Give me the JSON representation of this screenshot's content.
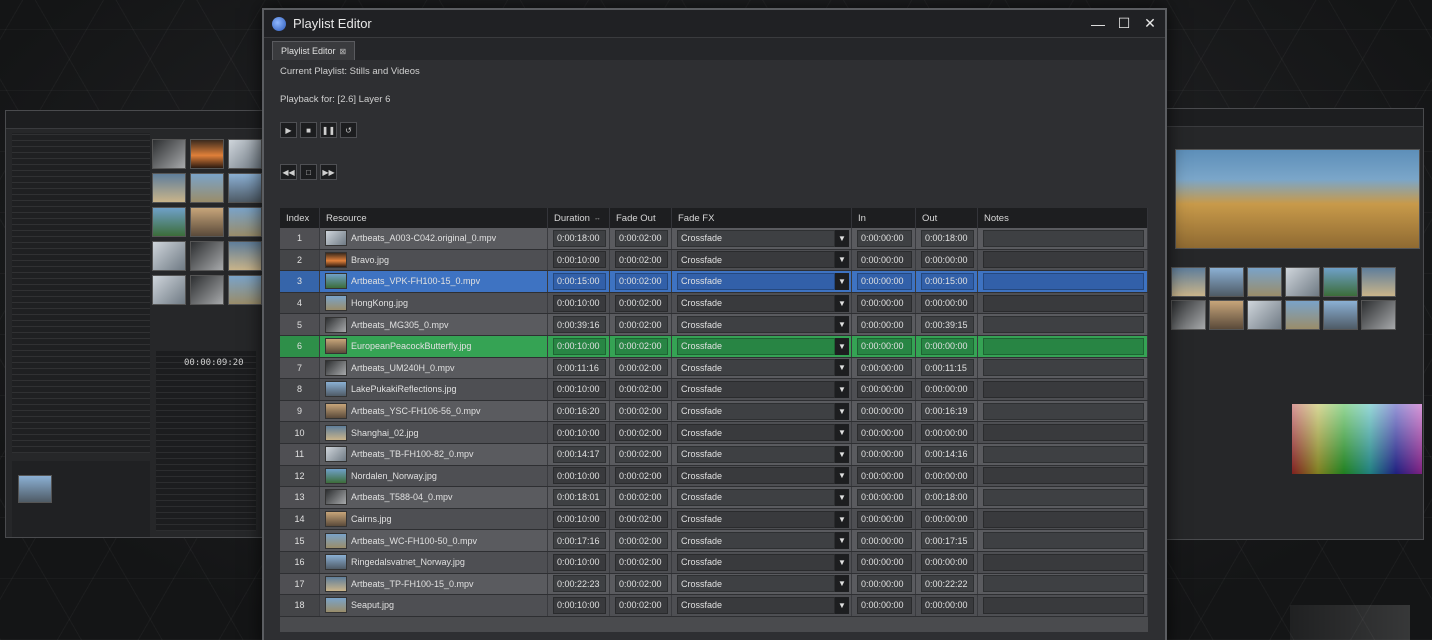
{
  "window": {
    "title": "Playlist Editor"
  },
  "tab": {
    "label": "Playlist Editor",
    "close_glyph": "⊠"
  },
  "info": {
    "current_playlist": "Current Playlist: Stills and Videos",
    "playback_for": "Playback for:  [2.6] Layer 6"
  },
  "background_app": {
    "timecode": "00:00:09:20"
  },
  "table": {
    "headers": {
      "index": "Index",
      "resource": "Resource",
      "duration": "Duration",
      "fade_out": "Fade Out",
      "fade_fx": "Fade FX",
      "in": "In",
      "out": "Out",
      "notes": "Notes"
    },
    "rows": [
      {
        "index": "1",
        "resource": "Artbeats_A003-C042.original_0.mpv",
        "duration": "0:00:18:00",
        "fade_out": "0:00:02:00",
        "fade_fx": "Crossfade",
        "in": "0:00:00:00",
        "out": "0:00:18:00",
        "thumb": "t3"
      },
      {
        "index": "2",
        "resource": "Bravo.jpg",
        "duration": "0:00:10:00",
        "fade_out": "0:00:02:00",
        "fade_fx": "Crossfade",
        "in": "0:00:00:00",
        "out": "0:00:00:00",
        "thumb": "t2"
      },
      {
        "index": "3",
        "resource": "Artbeats_VPK-FH100-15_0.mpv",
        "duration": "0:00:15:00",
        "fade_out": "0:00:02:00",
        "fade_fx": "Crossfade",
        "in": "0:00:00:00",
        "out": "0:00:15:00",
        "thumb": "t7",
        "state": "selected-blue"
      },
      {
        "index": "4",
        "resource": "HongKong.jpg",
        "duration": "0:00:10:00",
        "fade_out": "0:00:02:00",
        "fade_fx": "Crossfade",
        "in": "0:00:00:00",
        "out": "0:00:00:00",
        "thumb": "t1"
      },
      {
        "index": "5",
        "resource": "Artbeats_MG305_0.mpv",
        "duration": "0:00:39:16",
        "fade_out": "0:00:02:00",
        "fade_fx": "Crossfade",
        "in": "0:00:00:00",
        "out": "0:00:39:15",
        "thumb": "t6"
      },
      {
        "index": "6",
        "resource": "EuropeanPeacockButterfly.jpg",
        "duration": "0:00:10:00",
        "fade_out": "0:00:02:00",
        "fade_fx": "Crossfade",
        "in": "0:00:00:00",
        "out": "0:00:00:00",
        "thumb": "t8",
        "state": "selected-green"
      },
      {
        "index": "7",
        "resource": "Artbeats_UM240H_0.mpv",
        "duration": "0:00:11:16",
        "fade_out": "0:00:02:00",
        "fade_fx": "Crossfade",
        "in": "0:00:00:00",
        "out": "0:00:11:15",
        "thumb": "t6"
      },
      {
        "index": "8",
        "resource": "LakePukakiReflections.jpg",
        "duration": "0:00:10:00",
        "fade_out": "0:00:02:00",
        "fade_fx": "Crossfade",
        "in": "0:00:00:00",
        "out": "0:00:00:00",
        "thumb": "t4"
      },
      {
        "index": "9",
        "resource": "Artbeats_YSC-FH106-56_0.mpv",
        "duration": "0:00:16:20",
        "fade_out": "0:00:02:00",
        "fade_fx": "Crossfade",
        "in": "0:00:00:00",
        "out": "0:00:16:19",
        "thumb": "t8"
      },
      {
        "index": "10",
        "resource": "Shanghai_02.jpg",
        "duration": "0:00:10:00",
        "fade_out": "0:00:02:00",
        "fade_fx": "Crossfade",
        "in": "0:00:00:00",
        "out": "0:00:00:00",
        "thumb": "t5"
      },
      {
        "index": "11",
        "resource": "Artbeats_TB-FH100-82_0.mpv",
        "duration": "0:00:14:17",
        "fade_out": "0:00:02:00",
        "fade_fx": "Crossfade",
        "in": "0:00:00:00",
        "out": "0:00:14:16",
        "thumb": "t3"
      },
      {
        "index": "12",
        "resource": "Nordalen_Norway.jpg",
        "duration": "0:00:10:00",
        "fade_out": "0:00:02:00",
        "fade_fx": "Crossfade",
        "in": "0:00:00:00",
        "out": "0:00:00:00",
        "thumb": "t7"
      },
      {
        "index": "13",
        "resource": "Artbeats_T588-04_0.mpv",
        "duration": "0:00:18:01",
        "fade_out": "0:00:02:00",
        "fade_fx": "Crossfade",
        "in": "0:00:00:00",
        "out": "0:00:18:00",
        "thumb": "t6"
      },
      {
        "index": "14",
        "resource": "Cairns.jpg",
        "duration": "0:00:10:00",
        "fade_out": "0:00:02:00",
        "fade_fx": "Crossfade",
        "in": "0:00:00:00",
        "out": "0:00:00:00",
        "thumb": "t8"
      },
      {
        "index": "15",
        "resource": "Artbeats_WC-FH100-50_0.mpv",
        "duration": "0:00:17:16",
        "fade_out": "0:00:02:00",
        "fade_fx": "Crossfade",
        "in": "0:00:00:00",
        "out": "0:00:17:15",
        "thumb": "t1"
      },
      {
        "index": "16",
        "resource": "Ringedalsvatnet_Norway.jpg",
        "duration": "0:00:10:00",
        "fade_out": "0:00:02:00",
        "fade_fx": "Crossfade",
        "in": "0:00:00:00",
        "out": "0:00:00:00",
        "thumb": "t4"
      },
      {
        "index": "17",
        "resource": "Artbeats_TP-FH100-15_0.mpv",
        "duration": "0:00:22:23",
        "fade_out": "0:00:02:00",
        "fade_fx": "Crossfade",
        "in": "0:00:00:00",
        "out": "0:00:22:22",
        "thumb": "t5"
      },
      {
        "index": "18",
        "resource": "Seaput.jpg",
        "duration": "0:00:10:00",
        "fade_out": "0:00:02:00",
        "fade_fx": "Crossfade",
        "in": "0:00:00:00",
        "out": "0:00:00:00",
        "thumb": "t1"
      }
    ]
  },
  "colors": {
    "selected_blue": "#3e73c2",
    "selected_green": "#35a354",
    "window_bg": "#2c2d30"
  }
}
